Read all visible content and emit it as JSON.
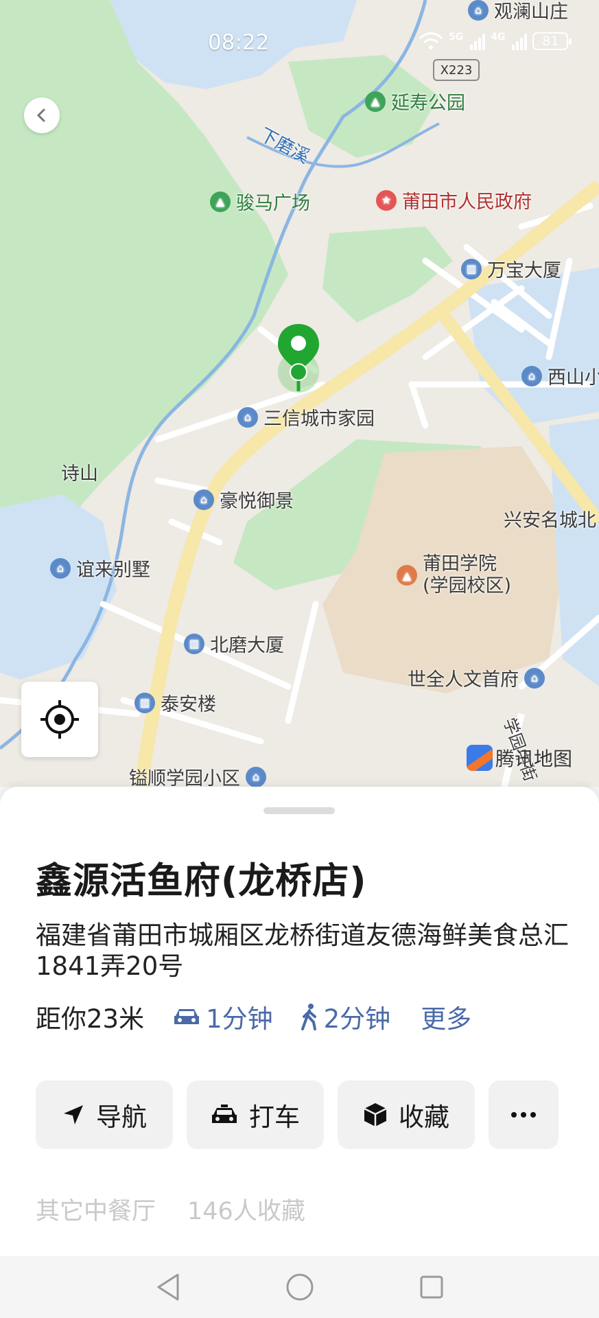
{
  "status": {
    "time": "08:22",
    "net1": "5G",
    "net2": "4G",
    "battery": "81"
  },
  "map": {
    "road_tag": "X223",
    "watermark": "腾讯地图",
    "labels": {
      "guanlan": "观澜山庄",
      "yanshou": "延寿公园",
      "river": "下磨溪",
      "junma": "骏马广场",
      "gov": "莆田市人民政府",
      "wanbao": "万宝大厦",
      "xishan": "西山小",
      "sanxin": "三信城市家园",
      "shishan": "诗山",
      "haoyue": "豪悦御景",
      "xinganming": "兴安名城北",
      "yilai": "谊来别墅",
      "putian_uni": "莆田学院",
      "putian_uni2": "(学园校区)",
      "bemo": "北磨大厦",
      "shiquan": "世全人文首府",
      "taian": "泰安楼",
      "yishun": "镒顺学园小区",
      "xueyuan_road": "学园中街"
    }
  },
  "place": {
    "name": "鑫源活鱼府(龙桥店)",
    "address": "福建省莆田市城厢区龙桥街道友德海鲜美食总汇1841弄20号",
    "distance": "距你23米",
    "drive_time": "1分钟",
    "walk_time": "2分钟",
    "more": "更多",
    "category": "其它中餐厅",
    "favorites": "146人收藏"
  },
  "actions": {
    "navigate": "导航",
    "taxi": "打车",
    "favorite": "收藏"
  },
  "colors": {
    "accent": "#4a6aa8",
    "pin": "#21a632",
    "park": "#c5e8c2",
    "water": "#cfe2f3",
    "road": "#f9ecb8"
  }
}
